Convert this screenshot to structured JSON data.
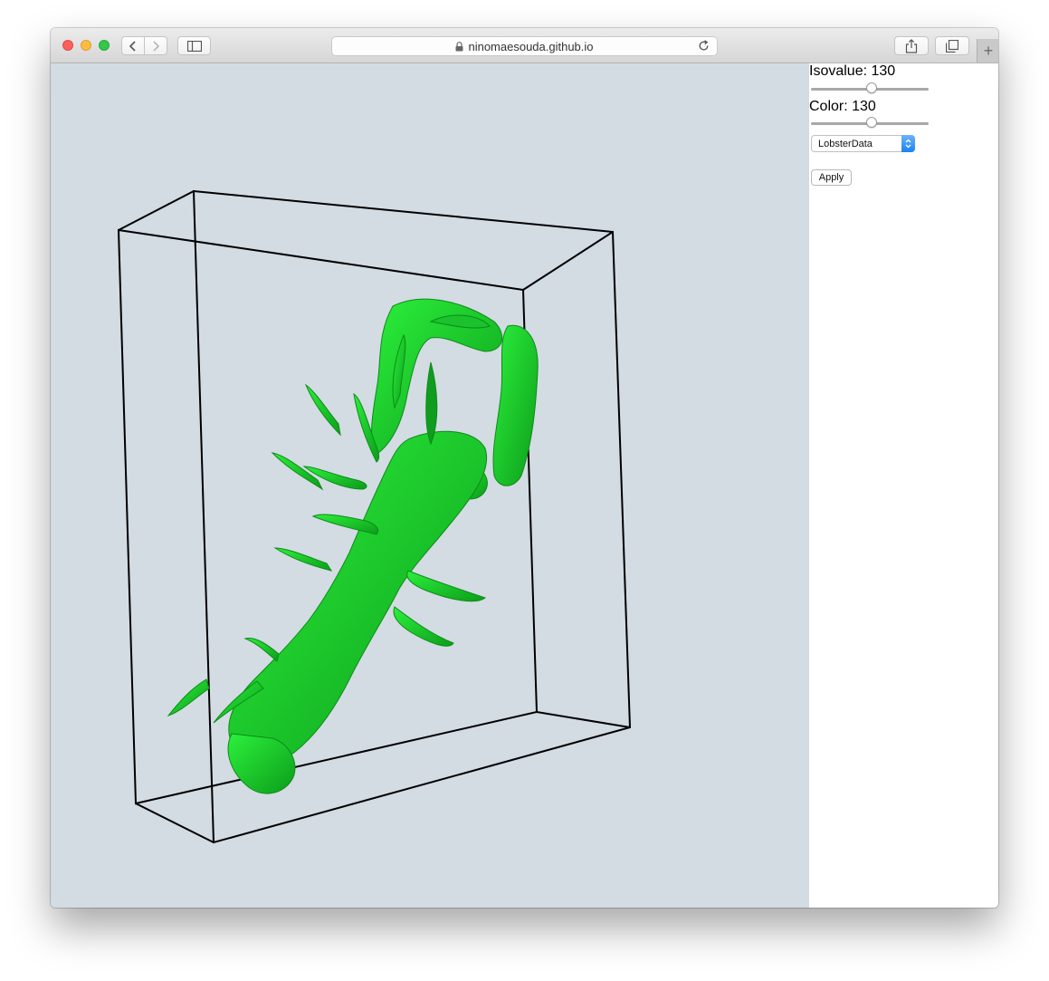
{
  "browser": {
    "url": "ninomaesouda.github.io",
    "new_tab_symbol": "+"
  },
  "controls": {
    "isovalue_label": "Isovalue: 130",
    "isovalue": 130,
    "color_label": "Color: 130",
    "color": 130,
    "slider_min": 0,
    "slider_max": 255,
    "dataset_selected": "LobsterData",
    "apply_label": "Apply"
  },
  "scene": {
    "background": "#d3dbe3",
    "box_color": "#000000",
    "surface_color": "#16e02a",
    "surface_shadow": "#0a8d16"
  }
}
